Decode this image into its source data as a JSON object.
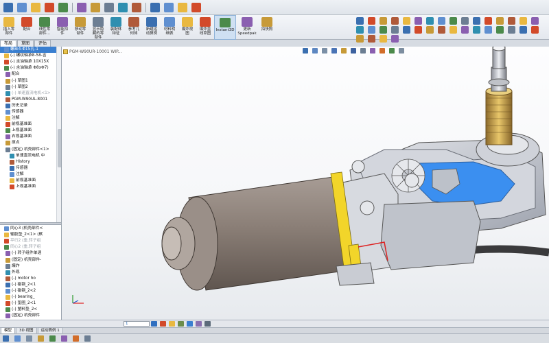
{
  "colors": {
    "accent": "#3a7fd0",
    "highlight_yellow": "#f2d52a",
    "motor_brown": "#8a7e76",
    "gearbox_blue": "#3b8ff0",
    "housing_gray": "#c8cbd3"
  },
  "toolbar_icons": [
    "new-icon",
    "open-icon",
    "save-icon",
    "print-icon",
    "undo-icon",
    "select-icon",
    "rebuild-icon",
    "options-icon",
    "search-icon",
    "zoom-icon",
    "section-view-icon",
    "display-style-icon",
    "view-settings-icon",
    "help-icon"
  ],
  "ribbon": {
    "buttons": [
      {
        "label": "插入零\n部件",
        "icon": "insert-component-icon"
      },
      {
        "label": "配合",
        "icon": "mate-icon"
      },
      {
        "label": "线性零\n部件...",
        "icon": "linear-pattern-icon"
      },
      {
        "label": "智能扣\n件",
        "icon": "smart-fastener-icon"
      },
      {
        "label": "移动零\n部件",
        "icon": "move-component-icon"
      },
      {
        "label": "显示隐\n藏的零\n部件",
        "icon": "show-hidden-icon"
      },
      {
        "label": "装配体\n特征",
        "icon": "assembly-feature-icon"
      },
      {
        "label": "参考几\n何体",
        "icon": "reference-geometry-icon"
      },
      {
        "label": "新建运\n动算例",
        "icon": "motion-study-icon"
      },
      {
        "label": "材料明\n细表",
        "icon": "bom-icon"
      },
      {
        "label": "爆炸视\n图",
        "icon": "exploded-view-icon"
      },
      {
        "label": "爆炸直\n线草图",
        "icon": "explode-line-icon"
      },
      {
        "label": "Instant3D",
        "icon": "instant3d-icon"
      },
      {
        "label": "更新\nSpeedpak",
        "icon": "speedpak-icon"
      },
      {
        "label": "拍快照",
        "icon": "snapshot-icon"
      }
    ]
  },
  "command_tabs": [
    "布局",
    "草图",
    "评估"
  ],
  "tree_upper": [
    {
      "label": "螺丝4-Φ15孔-1",
      "icon": "hole-icon",
      "selected": true
    },
    {
      "label": "(-) 螺纹轴承8-58-含",
      "icon": "part-icon"
    },
    {
      "label": "(-) 含油轴承 10X15X",
      "icon": "part-icon"
    },
    {
      "label": "(-) 含油轴承 Φ8xΦ7)",
      "icon": "part-icon"
    },
    {
      "label": "配合",
      "icon": "mates-folder-icon"
    },
    {
      "label": "(-) 草图1",
      "icon": "sketch-icon"
    },
    {
      "label": "(-) 草图2",
      "icon": "sketch-icon"
    },
    {
      "label": "(-) 单速直流电机<1>",
      "icon": "subassembly-icon",
      "dim": true
    },
    {
      "label": "PGM-W90UL-8001",
      "icon": "assembly-icon"
    },
    {
      "label": "历史记录",
      "icon": "history-icon"
    },
    {
      "label": "传感器",
      "icon": "sensor-icon"
    },
    {
      "label": "注解",
      "icon": "annotation-icon"
    },
    {
      "label": "前视基准面",
      "icon": "plane-icon"
    },
    {
      "label": "上视基准面",
      "icon": "plane-icon"
    },
    {
      "label": "右视基准面",
      "icon": "plane-icon"
    },
    {
      "label": "原点",
      "icon": "origin-icon"
    },
    {
      "label": "(固定) 机壳部件<1>",
      "icon": "subassembly-icon"
    },
    {
      "label": "单速直流电机 中",
      "icon": "subassembly-icon"
    },
    {
      "label": "History",
      "icon": "history-icon"
    },
    {
      "label": "传感器",
      "icon": "sensor-icon"
    },
    {
      "label": "注解",
      "icon": "annotation-icon"
    },
    {
      "label": "前视基准面",
      "icon": "plane-icon"
    },
    {
      "label": "上视基准面",
      "icon": "plane-icon"
    }
  ],
  "tree_lower": [
    {
      "label": "同心3 (机壳部件<",
      "icon": "concentric-icon"
    },
    {
      "label": "输胶垫_2<1> (默",
      "icon": "part-icon"
    },
    {
      "label": "平行2 (重.转子组",
      "icon": "mate-icon",
      "dim": true
    },
    {
      "label": "同心2 (重.转子组",
      "icon": "mate-icon",
      "dim": true
    },
    {
      "label": "(-) 转子组件单速",
      "icon": "subassembly-icon"
    },
    {
      "label": "(固定) 机壳部件-",
      "icon": "subassembly-icon"
    },
    {
      "label": "爆炸",
      "icon": "explode-icon"
    },
    {
      "label": "外观",
      "icon": "appearance-icon"
    },
    {
      "label": "(-) motor ho",
      "icon": "part-icon"
    },
    {
      "label": "(-) 磁钢_2<1",
      "icon": "part-icon"
    },
    {
      "label": "(-) 磁钢_2<2",
      "icon": "part-icon"
    },
    {
      "label": "(-) bearing_",
      "icon": "part-icon"
    },
    {
      "label": "(-) 垫圈_2<1",
      "icon": "part-icon"
    },
    {
      "label": "(-) 塑料垫_2<",
      "icon": "part-icon"
    },
    {
      "label": "(固定) 机壳部件",
      "icon": "subassembly-icon"
    }
  ],
  "viewport": {
    "document_title": "PGM-W90UR-10001 WIP..."
  },
  "model_tabs": [
    "模型",
    "3D 视图",
    "运动算例 1"
  ],
  "statusbar": {
    "field_value": "1"
  }
}
